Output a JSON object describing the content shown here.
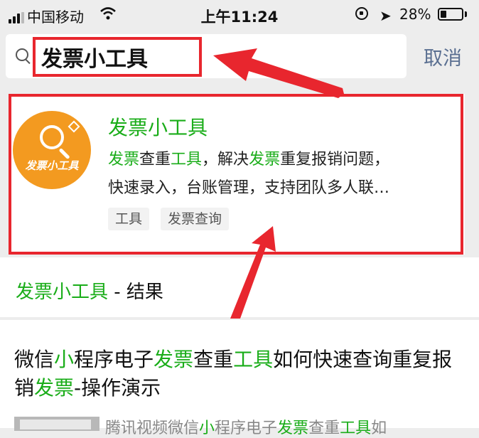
{
  "status": {
    "carrier": "中国移动",
    "time": "上午11:24",
    "battery": "28%",
    "battery_level": 0.28
  },
  "search": {
    "query": "发票小工具",
    "cancel_label": "取消"
  },
  "result": {
    "logo_text": "发票小工具",
    "title": "发票小工具",
    "desc_line1": [
      {
        "t": "发票",
        "hl": true
      },
      {
        "t": "查重",
        "hl": false
      },
      {
        "t": "工具",
        "hl": true
      },
      {
        "t": "，解决",
        "hl": false
      },
      {
        "t": "发票",
        "hl": true
      },
      {
        "t": "重复报销问题，",
        "hl": false
      }
    ],
    "desc_line2": "快速录入，台账管理，支持团队多人联…",
    "tags": [
      "工具",
      "发票查询"
    ]
  },
  "section": {
    "title_highlight": "发票小工具",
    "title_rest": " - 结果"
  },
  "article": {
    "title_parts": [
      {
        "t": "微信",
        "hl": false
      },
      {
        "t": "小",
        "hl": true
      },
      {
        "t": "程序电子",
        "hl": false
      },
      {
        "t": "发票",
        "hl": true
      },
      {
        "t": "查重",
        "hl": false
      },
      {
        "t": "工具",
        "hl": true
      },
      {
        "t": "如何快速查询重复报销",
        "hl": false
      },
      {
        "t": "发票",
        "hl": true
      },
      {
        "t": "-操作演示",
        "hl": false
      }
    ],
    "snippet_parts": [
      {
        "t": "腾讯视频微信",
        "hl": false
      },
      {
        "t": "小",
        "hl": true
      },
      {
        "t": "程序电子",
        "hl": false
      },
      {
        "t": "发票",
        "hl": true
      },
      {
        "t": "查重",
        "hl": false
      },
      {
        "t": "工具",
        "hl": true
      },
      {
        "t": "如",
        "hl": false
      }
    ]
  },
  "colors": {
    "highlight": "#1aad19",
    "annotation": "#e8262e",
    "cancel": "#5a6f91",
    "logo": "#f39a20"
  }
}
